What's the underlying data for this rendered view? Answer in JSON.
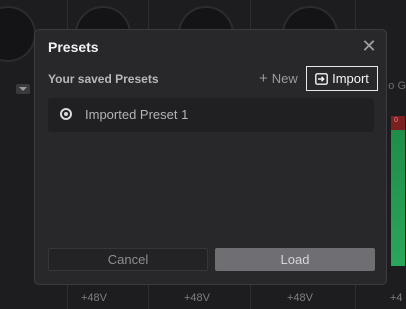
{
  "background": {
    "phantom_power_labels": [
      "+48V",
      "+48V",
      "+48V",
      "+4"
    ],
    "edge_text": "o G",
    "meter_clip_label": "0"
  },
  "dialog": {
    "title": "Presets",
    "section_label": "Your saved Presets",
    "new_label": "New",
    "import_label": "Import",
    "presets": [
      {
        "name": "Imported Preset 1",
        "selected": true
      }
    ],
    "cancel_label": "Cancel",
    "load_label": "Load"
  },
  "colors": {
    "dialog_bg": "#28282b",
    "load_button": "#6f6f73",
    "meter_green": "#2aa65a"
  }
}
